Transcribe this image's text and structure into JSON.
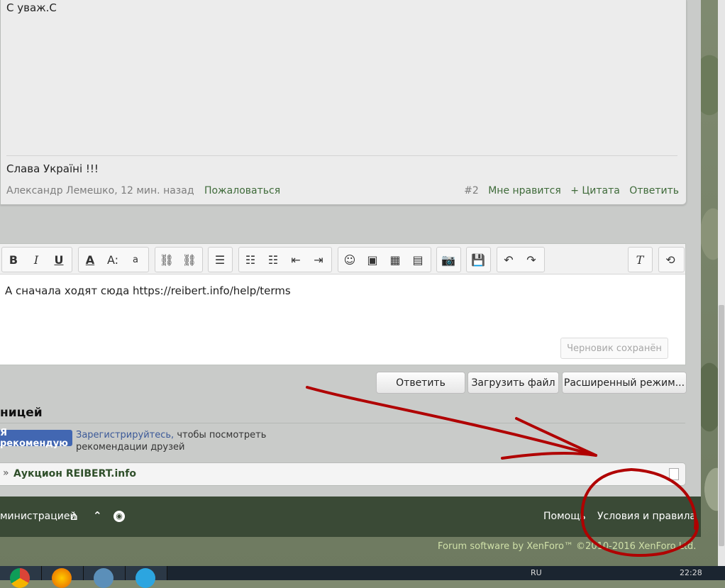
{
  "post": {
    "body_text": "С уваж.С",
    "signature": "Слава Україні !!!",
    "author_time": "Александр Лемешко, 12 мин. назад",
    "report_label": "Пожаловаться",
    "post_number": "#2",
    "like_label": "Мне нравится",
    "quote_label": "+ Цитата",
    "reply_label": "Ответить"
  },
  "editor": {
    "text": "А сначала ходят сюда https://reibert.info/help/terms",
    "draft_status": "Черновик сохранён",
    "toolbar": {
      "bold": "B",
      "italic": "I",
      "underline": "U",
      "font_color": "A",
      "font_size": "A:",
      "font_family": "a",
      "remove_format": "T"
    }
  },
  "actions": {
    "reply_button": "Ответить",
    "upload_button": "Загрузить файл",
    "advanced_button": "Расширенный режим..."
  },
  "share": {
    "heading": "ницей",
    "fb_button": "Я рекомендую",
    "fb_register": "Зарегистрируйтесь,",
    "fb_rest": "чтобы посмотреть рекомендации друзей"
  },
  "breadcrumb": {
    "arrow": "»",
    "item": "Аукцион REIBERT.info"
  },
  "footer": {
    "admin_link": "министрацией",
    "help_link": "Помощь",
    "terms_link": "Условия и правила",
    "copyright": "Forum software by XenForo™ ©2010-2016 XenForo Ltd."
  },
  "taskbar": {
    "lang": "RU",
    "clock": "22:28"
  },
  "colors": {
    "link_green": "#3f6b3a",
    "footer_bg": "#3a4a36",
    "annotation_red": "#b00000"
  }
}
